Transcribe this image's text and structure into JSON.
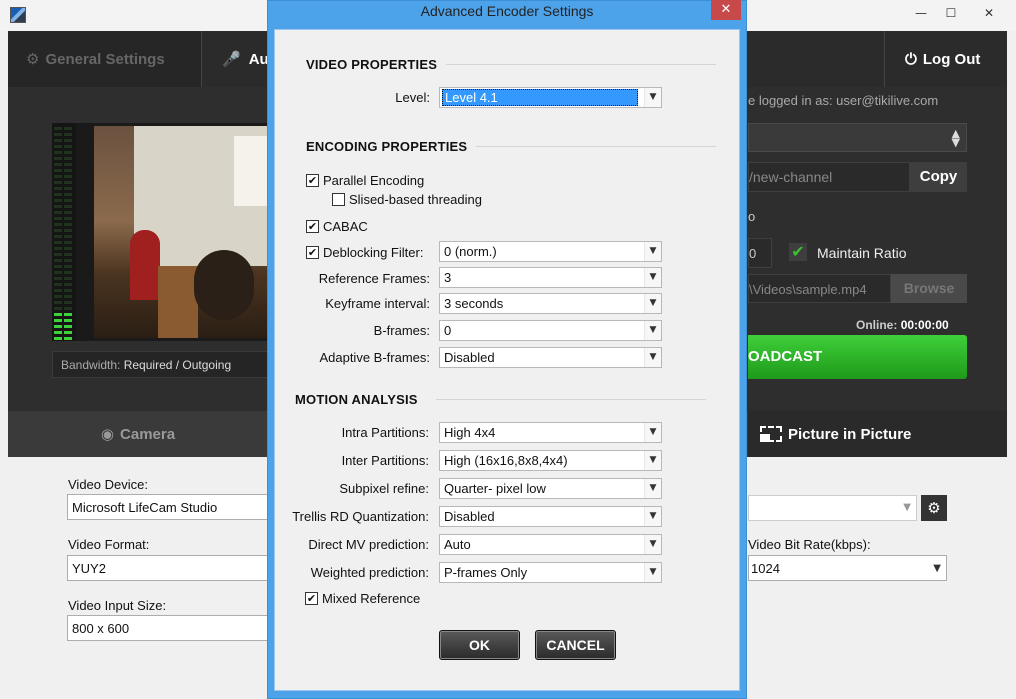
{
  "window": {
    "minimize_glyph": "—",
    "maximize_glyph": "☐",
    "close_glyph": "✕"
  },
  "topnav": {
    "general_settings": "General Settings",
    "audio": "Au",
    "logout": "Log Out"
  },
  "preview": {
    "bandwidth_label": "Bandwidth:",
    "bandwidth_value": "Required / Outgoing"
  },
  "right_panel": {
    "logged_in": "e logged in as:  user@tikilive.com",
    "channel_url": "/new-channel",
    "copy_label": "Copy",
    "o_text": "o",
    "w_value": "0",
    "maintain_ratio_label": "Maintain Ratio",
    "maintain_ratio_checked": true,
    "file_path": "\\Videos\\sample.mp4",
    "browse_label": "Browse",
    "online_label": "Online:",
    "online_time": "00:00:00",
    "broadcast_label": "OADCAST"
  },
  "bottom_tabs": {
    "camera": "Camera",
    "pip": "Picture in Picture"
  },
  "lower": {
    "video_device_label": "Video Device:",
    "video_device_value": "Microsoft LifeCam Studio",
    "video_format_label": "Video Format:",
    "video_format_value": "YUY2",
    "video_input_size_label": "Video Input Size:",
    "video_input_size_value": "800 x 600",
    "video_bitrate_label": "Video Bit Rate(kbps):",
    "video_bitrate_value": "1024"
  },
  "dialog": {
    "title": "Advanced Encoder Settings",
    "close_glyph": "✕",
    "video_properties": {
      "heading": "VIDEO PROPERTIES",
      "level_label": "Level:",
      "level_value": "Level 4.1"
    },
    "encoding_properties": {
      "heading": "ENCODING PROPERTIES",
      "parallel_encoding": {
        "label": "Parallel Encoding",
        "checked": true
      },
      "slised_threading": {
        "label": "Slised-based threading",
        "checked": false
      },
      "cabac": {
        "label": "CABAC",
        "checked": true
      },
      "deblocking": {
        "label": "Deblocking Filter:",
        "checked": true,
        "value": "0 (norm.)"
      },
      "reference_frames": {
        "label": "Reference Frames:",
        "value": "3"
      },
      "keyframe_interval": {
        "label": "Keyframe interval:",
        "value": "3  seconds"
      },
      "b_frames": {
        "label": "B-frames:",
        "value": "0"
      },
      "adaptive_b_frames": {
        "label": "Adaptive B-frames:",
        "value": "Disabled"
      }
    },
    "motion_analysis": {
      "heading": "MOTION ANALYSIS",
      "intra_partitions": {
        "label": "Intra Partitions:",
        "value": "High 4x4"
      },
      "inter_partitions": {
        "label": "Inter Partitions:",
        "value": "High  (16x16,8x8,4x4)"
      },
      "subpixel_refine": {
        "label": "Subpixel refine:",
        "value": "Quarter- pixel low"
      },
      "trellis": {
        "label": "Trellis RD Quantization:",
        "value": "Disabled"
      },
      "direct_mv": {
        "label": "Direct MV prediction:",
        "value": "Auto"
      },
      "weighted": {
        "label": "Weighted prediction:",
        "value": "P-frames Only"
      },
      "mixed_reference": {
        "label": "Mixed Reference",
        "checked": true
      }
    },
    "ok_label": "OK",
    "cancel_label": "CANCEL"
  },
  "icons": {
    "gear": "gear-icon",
    "microphone": "microphone-icon",
    "power": "power-icon",
    "webcam": "webcam-icon",
    "pip": "picture-in-picture-icon",
    "chevron": "chevron-down-icon",
    "checkmark": "checkmark-icon"
  },
  "colors": {
    "dialog_frame": "#4da3ea",
    "close_red": "#c74949",
    "broadcast_green": "#2eb52a",
    "dark_panel": "#2e2e2e",
    "selection_blue": "#3399ff"
  }
}
